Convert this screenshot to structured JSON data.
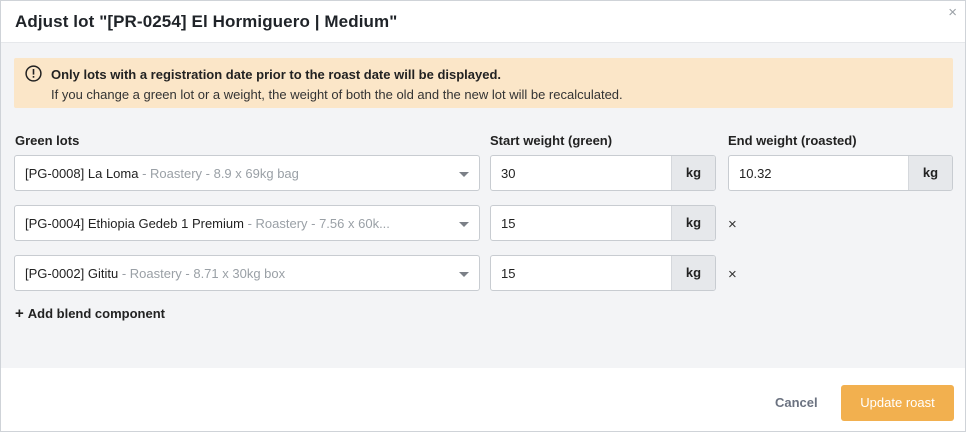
{
  "modal": {
    "title": "Adjust lot \"[PR-0254] El Hormiguero | Medium\"",
    "close_label": "×"
  },
  "alert": {
    "icon": "info-circle-icon",
    "title": "Only lots with a registration date prior to the roast date will be displayed.",
    "text": "If you change a green lot or a weight, the weight of both the old and the new lot will be recalculated."
  },
  "columns": {
    "green_lots": "Green lots",
    "start_weight": "Start weight (green)",
    "end_weight": "End weight (roasted)"
  },
  "rows": [
    {
      "lot_main": "[PG-0008] La Loma",
      "lot_meta": " - Roastery - 8.9 x 69kg bag",
      "start_weight": "30",
      "unit": "kg"
    },
    {
      "lot_main": "[PG-0004] Ethiopia Gedeb 1 Premium",
      "lot_meta": " - Roastery - 7.56 x 60k...",
      "start_weight": "15",
      "unit": "kg",
      "remove_label": "×"
    },
    {
      "lot_main": "[PG-0002] Gititu",
      "lot_meta": " - Roastery - 8.71 x 30kg box",
      "start_weight": "15",
      "unit": "kg",
      "remove_label": "×"
    }
  ],
  "end_weight": {
    "value": "10.32",
    "unit": "kg"
  },
  "add_component": {
    "plus": "+",
    "label": "Add blend component"
  },
  "footer": {
    "cancel_label": "Cancel",
    "update_label": "Update roast",
    "update_color": "#f2b04f"
  }
}
